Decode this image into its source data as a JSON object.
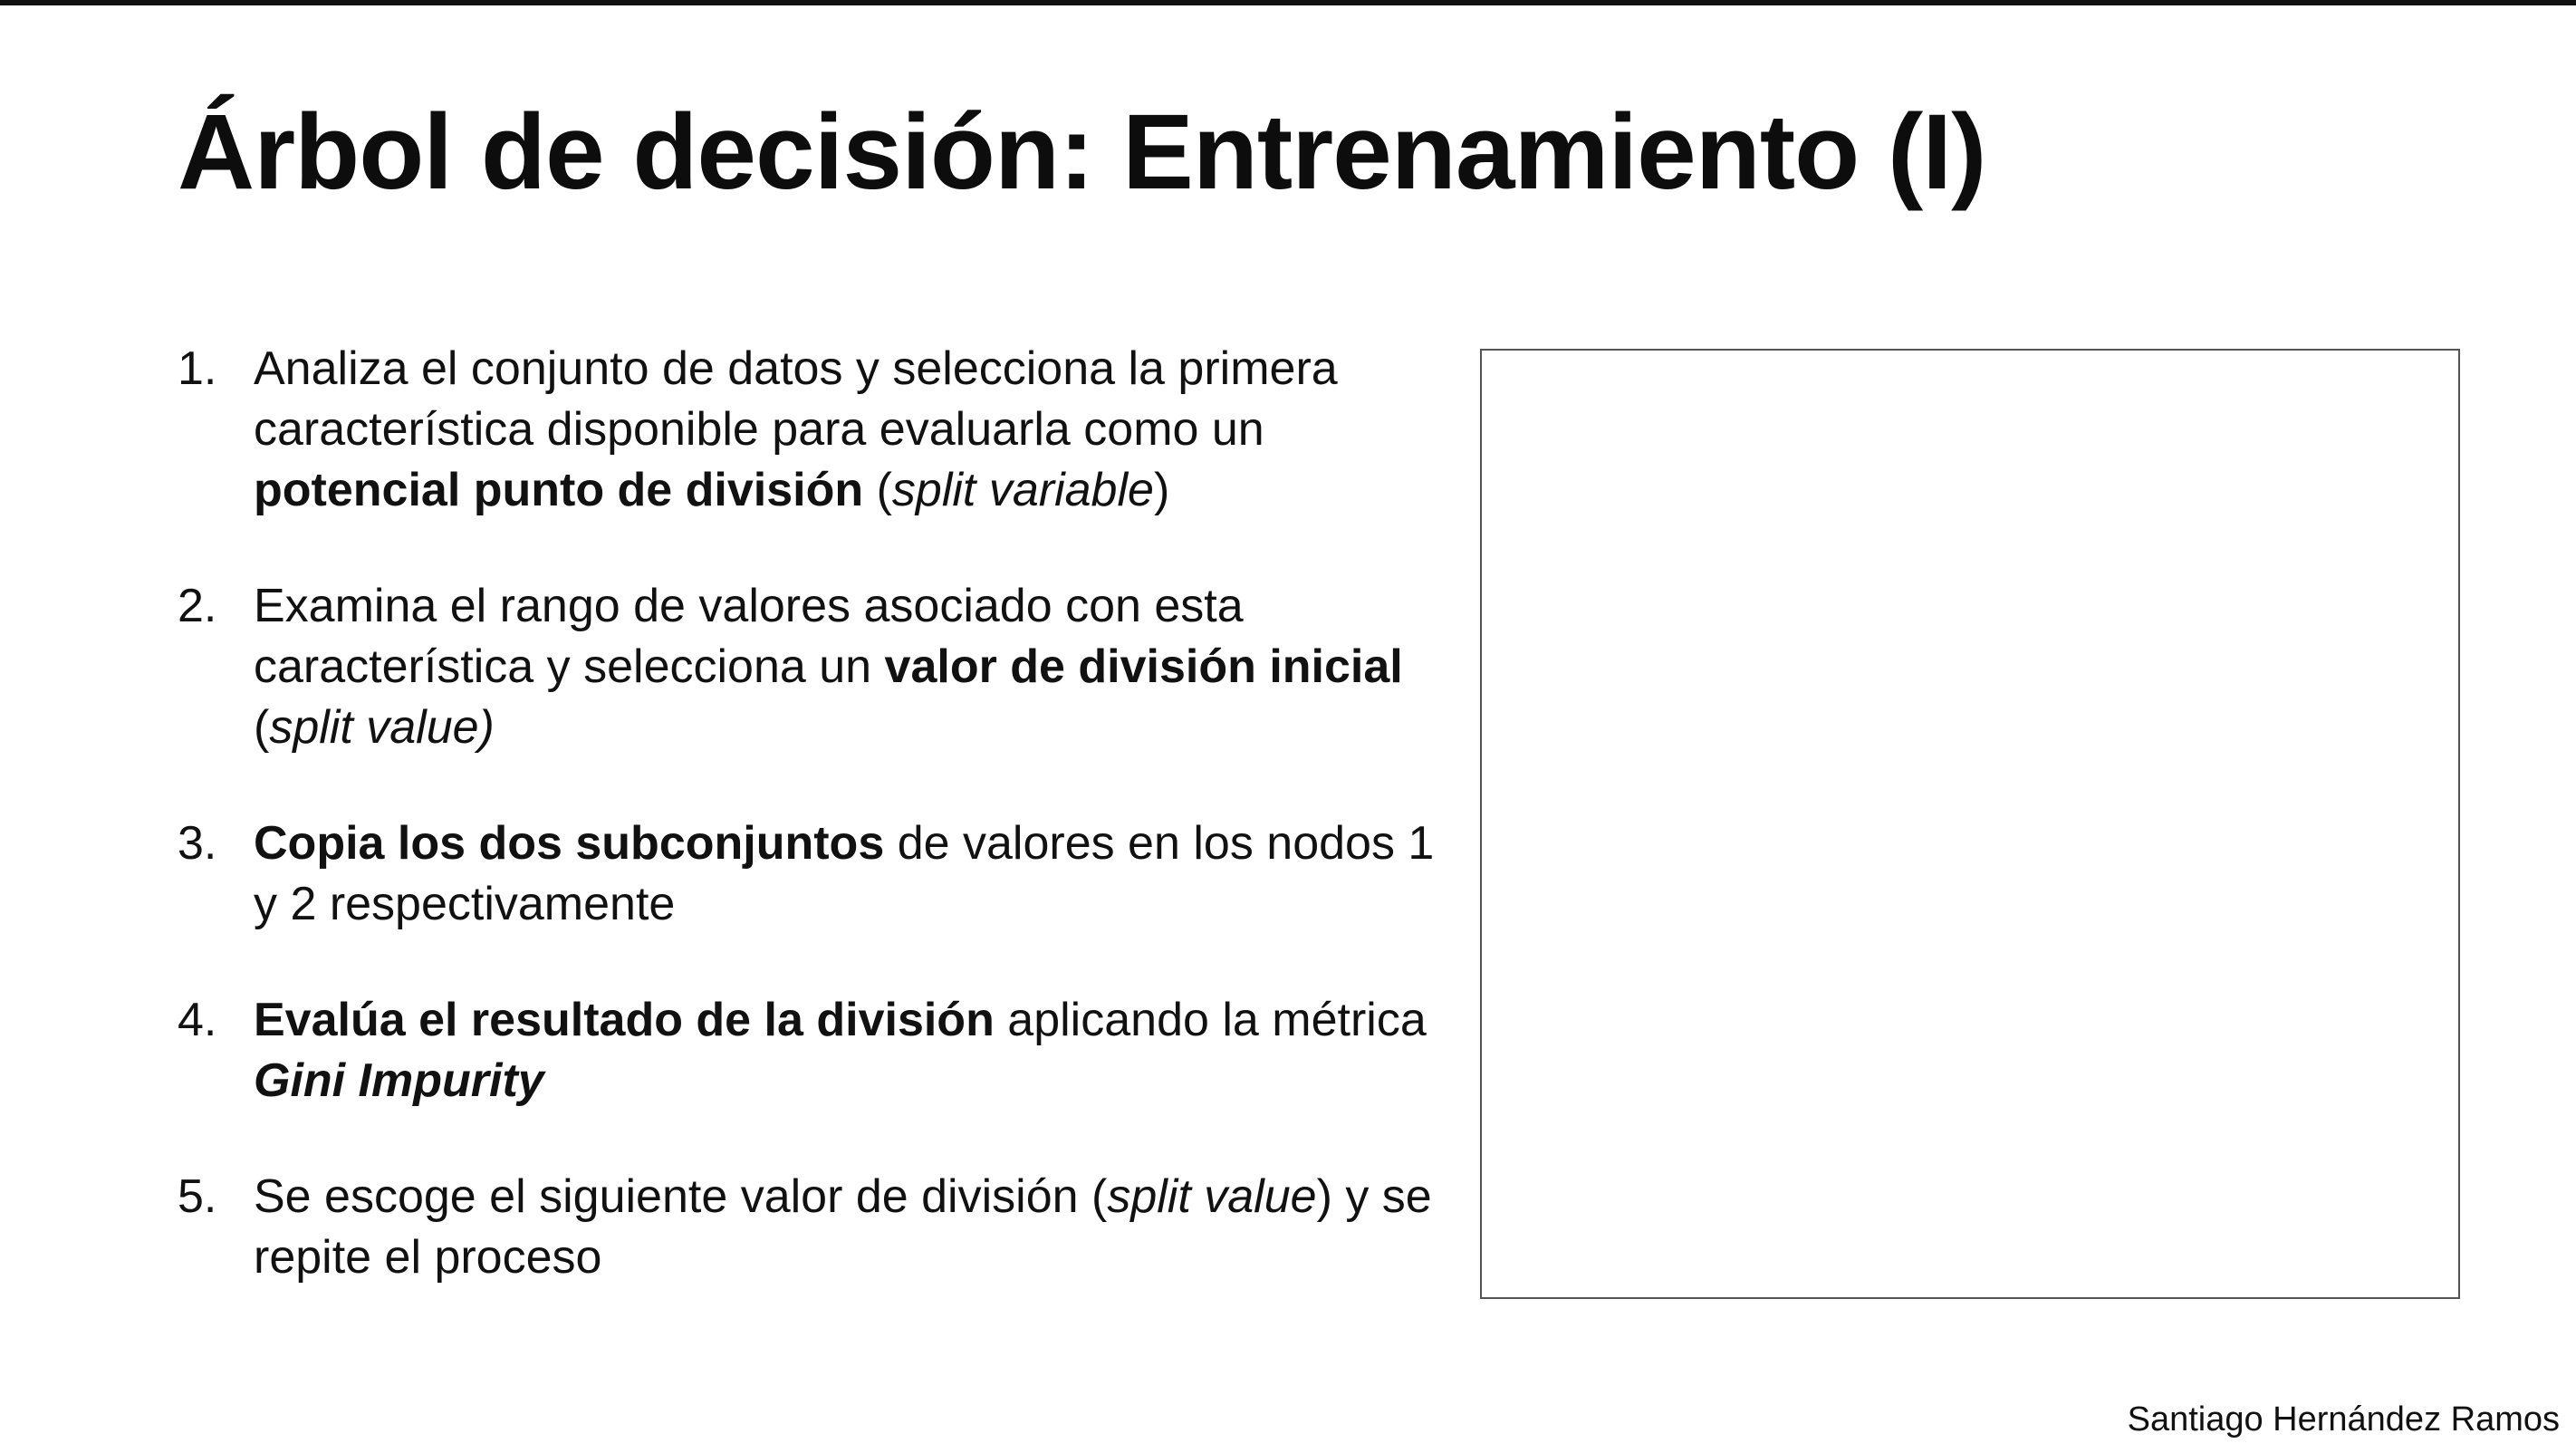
{
  "slide": {
    "title": "Árbol de decisión: Entrenamiento (I)",
    "author": "Santiago Hernández Ramos"
  },
  "steps": [
    {
      "number": "1.",
      "t1": "Analiza el conjunto de datos y selecciona la primera característica disponible para evaluarla como un ",
      "t2": "potencial punto de división",
      "t3": " (",
      "t4": "split variable",
      "t5": ")"
    },
    {
      "number": "2.",
      "t1": "Examina el rango de valores asociado con esta característica y selecciona un ",
      "t2": "valor de división inicial",
      "t3": " (",
      "t4": "split value)"
    },
    {
      "number": "3.",
      "t1": "Copia los dos subconjuntos",
      "t2": " de valores en los nodos 1 y 2 respectivamente"
    },
    {
      "number": "4.",
      "t1": "Evalúa el resultado de la división",
      "t2": " aplicando la métrica ",
      "t3": "Gini Impurity"
    },
    {
      "number": "5.",
      "t1": "Se escoge el siguiente valor de división (",
      "t2": "split value",
      "t3": ") y se repite el proceso"
    }
  ]
}
